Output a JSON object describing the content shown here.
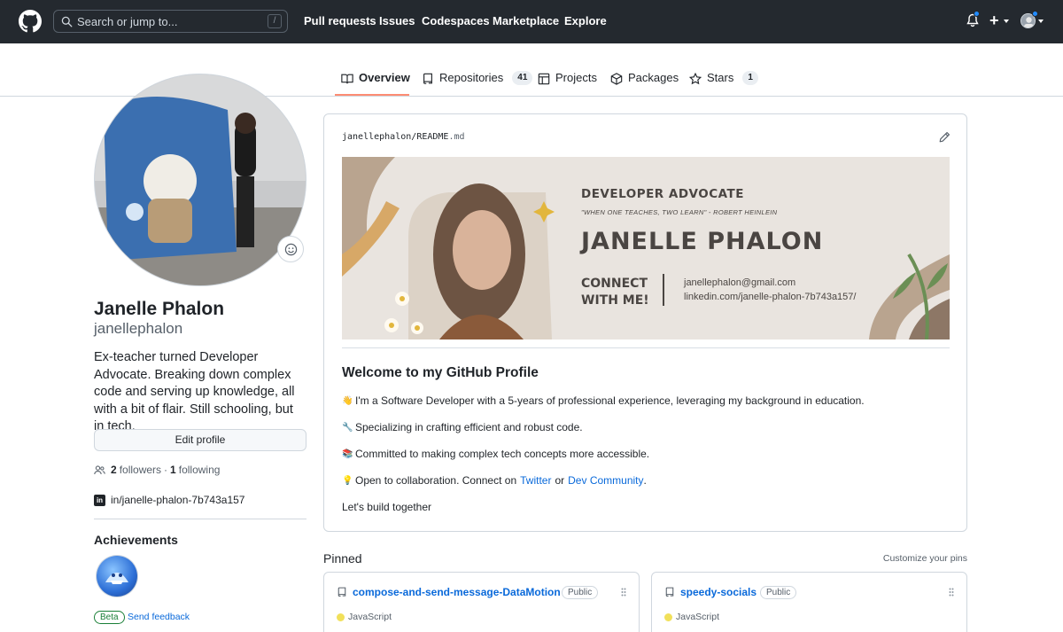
{
  "header": {
    "search_placeholder": "Search or jump to...",
    "search_shortcut": "/",
    "nav": [
      "Pull requests",
      "Issues",
      "Codespaces",
      "Marketplace",
      "Explore"
    ]
  },
  "tabs": [
    {
      "label": "Overview",
      "icon": "book-icon",
      "active": true
    },
    {
      "label": "Repositories",
      "icon": "repo-icon",
      "count": "41"
    },
    {
      "label": "Projects",
      "icon": "table-icon"
    },
    {
      "label": "Packages",
      "icon": "package-icon"
    },
    {
      "label": "Stars",
      "icon": "star-icon",
      "count": "1"
    }
  ],
  "profile": {
    "name": "Janelle Phalon",
    "login": "janellephalon",
    "bio": "Ex-teacher turned Developer Advocate. Breaking down complex code and serving up knowledge, all with a bit of flair. Still schooling, but in tech.",
    "edit_label": "Edit profile",
    "followers_count": "2",
    "followers_label": "followers",
    "separator": "·",
    "following_count": "1",
    "following_label": "following",
    "linkedin": "in/janelle-phalon-7b743a157",
    "achievements_title": "Achievements",
    "beta_label": "Beta",
    "feedback_label": "Send feedback"
  },
  "readme": {
    "path_user": "janellephalon",
    "path_sep": "/",
    "path_file": "README",
    "path_ext": ".md",
    "banner": {
      "role": "DEVELOPER ADVOCATE",
      "quote": "\"WHEN ONE TEACHES, TWO LEARN\" - ROBERT HEINLEIN",
      "name": "JANELLE PHALON",
      "connect_line1": "CONNECT",
      "connect_line2": "WITH ME!",
      "email": "janellephalon@gmail.com",
      "linkedin": "linkedin.com/janelle-phalon-7b743a157/"
    },
    "heading": "Welcome to my GitHub Profile",
    "lines": [
      {
        "emoji": "👋",
        "text": "I'm a Software Developer with a 5-years of professional experience, leveraging my background in education."
      },
      {
        "emoji": "🔧",
        "text": "Specializing in crafting efficient and robust code."
      },
      {
        "emoji": "📚",
        "text": "Committed to making complex tech concepts more accessible."
      }
    ],
    "collab": {
      "emoji": "💡",
      "text_before": "Open to collaboration. Connect on",
      "link1": "Twitter",
      "middle": "or",
      "link2": "Dev Community",
      "after": "."
    },
    "closing": "Let's build together"
  },
  "pinned": {
    "title": "Pinned",
    "customize": "Customize your pins",
    "repos": [
      {
        "name": "compose-and-send-message-DataMotion",
        "visibility": "Public",
        "language": "JavaScript"
      },
      {
        "name": "speedy-socials",
        "visibility": "Public",
        "language": "JavaScript"
      }
    ]
  },
  "colors": {
    "header_bg": "#24292f",
    "link": "#0969da",
    "tab_underline": "#fd8c73",
    "javascript": "#f1e05a"
  }
}
